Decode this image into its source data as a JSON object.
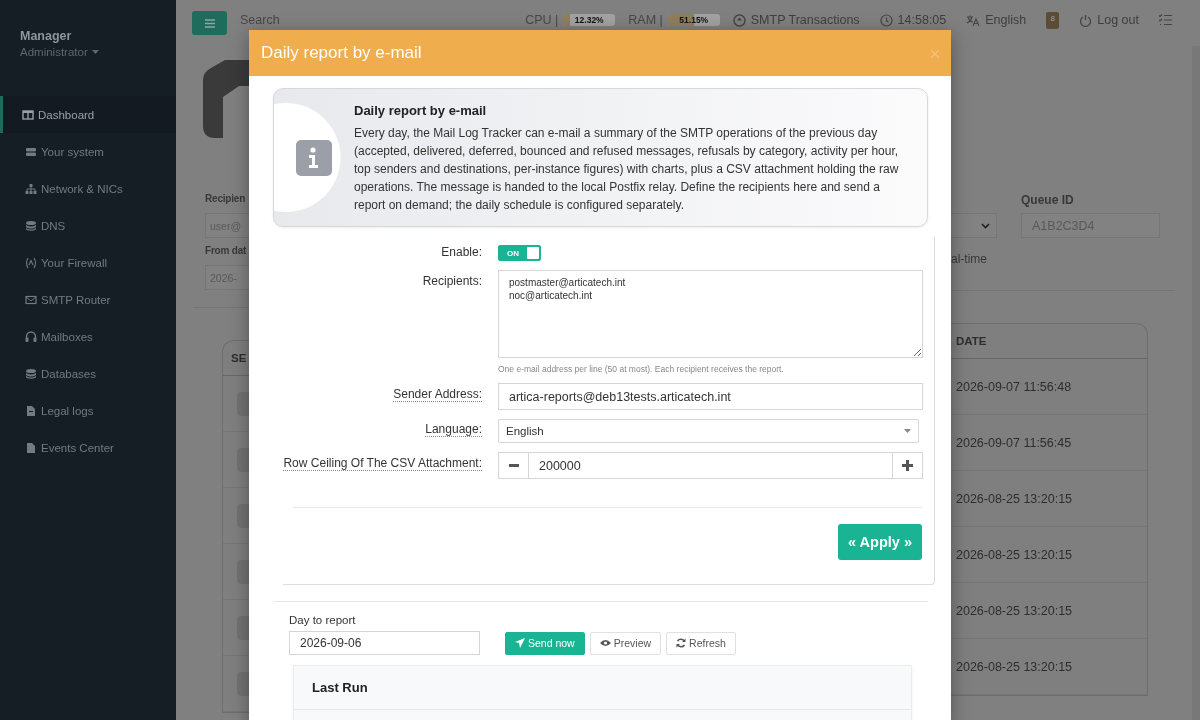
{
  "sidebar": {
    "user": "Manager",
    "role": "Administrator",
    "items": [
      {
        "label": "Dashboard",
        "selected": true
      },
      {
        "label": "Your system",
        "selected": false
      },
      {
        "label": "Network & NICs",
        "selected": false
      },
      {
        "label": "DNS",
        "selected": false
      },
      {
        "label": "Your Firewall",
        "selected": false
      },
      {
        "label": "SMTP Router",
        "selected": false
      },
      {
        "label": "Mailboxes",
        "selected": false
      },
      {
        "label": "Databases",
        "selected": false
      },
      {
        "label": "Legal logs",
        "selected": false
      },
      {
        "label": "Events Center",
        "selected": false
      }
    ]
  },
  "topbar": {
    "search": {
      "placeholder": "Search"
    },
    "meters": [
      {
        "label": "CPU |",
        "reading": "12.32%",
        "level": 0.12
      },
      {
        "label": "RAM |",
        "reading": "51.15%",
        "level": 0.51
      }
    ],
    "links": [
      {
        "label": "SMTP Transactions"
      },
      {
        "label": "14:58:05"
      },
      {
        "label": "English"
      }
    ],
    "notifications": "8",
    "logout": "Log out"
  },
  "filters": {
    "recipient": {
      "label": "Recipien",
      "placeholder": "user@"
    },
    "from_date": {
      "label": "From dat",
      "placeholder": "2026-"
    },
    "queue_id": {
      "label": "Queue ID",
      "placeholder": "A1B2C3D4"
    },
    "realtime": {
      "label": "al-time"
    }
  },
  "table": {
    "columns": [
      "SE",
      "DATE"
    ],
    "rows": [
      {
        "date": "2026-09-07 11:56:48"
      },
      {
        "date": "2026-09-07 11:56:45"
      },
      {
        "date": "2026-08-25 13:20:15"
      },
      {
        "date": "2026-08-25 13:20:15"
      },
      {
        "date": "2026-08-25 13:20:15"
      },
      {
        "date": "2026-08-25 13:20:15"
      }
    ]
  },
  "modal": {
    "title": "Daily report by e-mail",
    "info": {
      "title": "Daily report by e-mail",
      "text": "Every day, the Mail Log Tracker can e-mail a summary of the SMTP operations of the previous day (accepted, delivered, deferred, bounced and refused messages, refusals by category, activity per hour, top senders and destinations, per-instance figures) with charts, plus a CSV attachment holding the raw operations. The message is handed to the local Postfix relay. Define the recipients here and send a report on demand; the daily schedule is configured separately."
    },
    "fields": [
      {
        "kind": "toggle",
        "label": "Enable:",
        "help": false,
        "on": true,
        "text": "ON"
      },
      {
        "kind": "textarea",
        "label": "Recipients:",
        "help": false,
        "value": "postmaster@articatech.int\nnoc@articatech.int",
        "note": "One e-mail address per line (50 at most). Each recipient receives the report."
      },
      {
        "kind": "text",
        "label": "Sender Address:",
        "help": true,
        "value": "artica-reports@deb13tests.articatech.int"
      },
      {
        "kind": "select",
        "label": "Language:",
        "help": true,
        "value": "English"
      },
      {
        "kind": "stepper",
        "label": "Row Ceiling Of The CSV Attachment:",
        "help": true,
        "value": "200000"
      }
    ],
    "apply": "« Apply »",
    "report": {
      "label": "Day to report",
      "value": "2026-09-06",
      "buttons": [
        {
          "label": "Send now",
          "kind": "primary"
        },
        {
          "label": "Preview",
          "kind": "default"
        },
        {
          "label": "Refresh",
          "kind": "default"
        }
      ]
    },
    "last_run": {
      "title": "Last Run"
    }
  }
}
